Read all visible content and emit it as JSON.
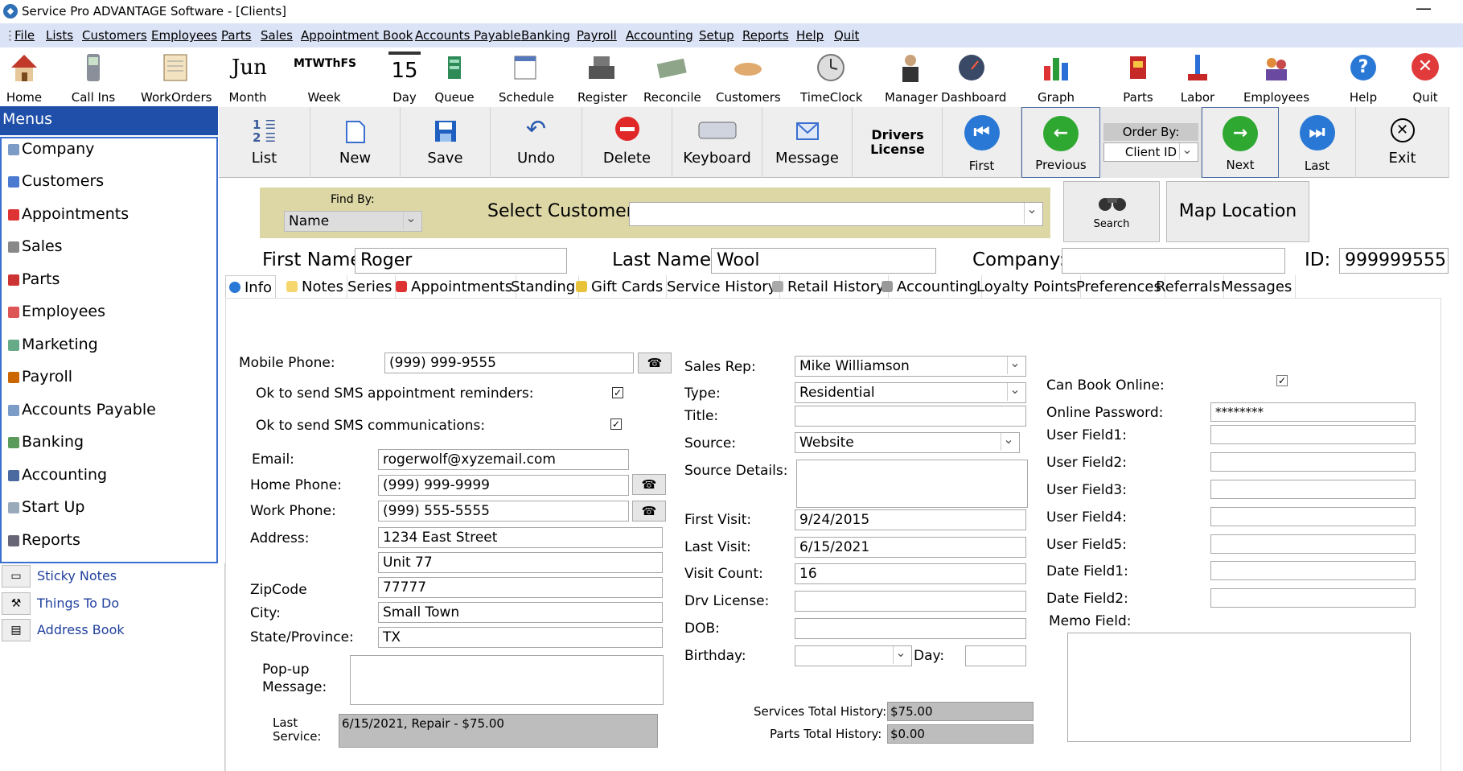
{
  "window": {
    "title": "Service Pro ADVANTAGE Software - [Clients]",
    "minimize": "—"
  },
  "menubar": [
    "File",
    "Lists",
    "Customers",
    "Employees",
    "Parts",
    "Sales",
    "Appointment Book",
    "Accounts Payable",
    "Banking",
    "Payroll",
    "Accounting",
    "Setup",
    "Reports",
    "Help",
    "Quit"
  ],
  "toolbar": {
    "home": "Home",
    "callins": "Call Ins",
    "workorders": "WorkOrders",
    "month": "Month",
    "month_icon": "Jun",
    "week": "Week",
    "week_icon": "MTWThFS",
    "day": "Day",
    "day_icon": "15",
    "queue": "Queue",
    "schedule": "Schedule",
    "register": "Register",
    "reconcile": "Reconcile",
    "customers": "Customers",
    "timeclock": "TimeClock",
    "manager": "Manager",
    "dashboard": "Dashboard",
    "graph": "Graph",
    "parts": "Parts",
    "labor": "Labor",
    "employees": "Employees",
    "help": "Help",
    "quit": "Quit"
  },
  "sidebar": {
    "header": "Menus",
    "items": [
      "Company",
      "Customers",
      "Appointments",
      "Sales",
      "Parts",
      "Employees",
      "Marketing",
      "Payroll",
      "Accounts Payable",
      "Banking",
      "Accounting",
      "Start Up",
      "Reports"
    ],
    "extras": [
      "Sticky Notes",
      "Things To Do",
      "Address Book"
    ]
  },
  "commands": {
    "list": "List",
    "new": "New",
    "save": "Save",
    "undo": "Undo",
    "delete": "Delete",
    "keyboard": "Keyboard",
    "message": "Message",
    "drivers_license": "Drivers License",
    "first": "First",
    "previous": "Previous",
    "order_by_label": "Order By:",
    "order_by_value": "Client ID",
    "next": "Next",
    "last": "Last",
    "exit": "Exit"
  },
  "find": {
    "find_by_label": "Find By:",
    "find_by_value": "Name",
    "select_customer_label": "Select Customer",
    "select_customer_value": "",
    "search": "Search",
    "map_location": "Map Location"
  },
  "header_fields": {
    "first_name_label": "First Name:",
    "first_name": "Roger",
    "last_name_label": "Last Name:",
    "last_name": "Wool",
    "company_label": "Company:",
    "company": "",
    "id_label": "ID:",
    "id": "999999555"
  },
  "tabs": [
    "Info",
    "Notes",
    "Series",
    "Appointments",
    "Standing",
    "Gift Cards",
    "Service History",
    "Retail History",
    "Accounting",
    "Loyalty Points",
    "Preferences",
    "Referrals",
    "Messages"
  ],
  "info": {
    "mobile_label": "Mobile Phone:",
    "mobile": "(999) 999-9555",
    "sms_reminders_label": "Ok to send SMS appointment reminders:",
    "sms_reminders": true,
    "sms_comm_label": "Ok to send SMS communications:",
    "sms_comm": true,
    "email_label": "Email:",
    "email": "rogerwolf@xyzemail.com",
    "home_label": "Home Phone:",
    "home": "(999) 999-9999",
    "work_label": "Work Phone:",
    "work": "(999) 555-5555",
    "address_label": "Address:",
    "address1": "1234 East Street",
    "address2": "Unit 77",
    "zip_label": "ZipCode",
    "zip": "77777",
    "city_label": "City:",
    "city": "Small Town",
    "state_label": "State/Province:",
    "state": "TX",
    "popup_label1": "Pop-up",
    "popup_label2": "Message:",
    "popup": "",
    "last_service_label1": "Last",
    "last_service_label2": "Service:",
    "last_service": "6/15/2021, Repair - $75.00",
    "sales_rep_label": "Sales Rep:",
    "sales_rep": "Mike Williamson",
    "type_label": "Type:",
    "type": "Residential",
    "title_label": "Title:",
    "title": "",
    "source_label": "Source:",
    "source": "Website",
    "source_details_label": "Source Details:",
    "source_details": "",
    "first_visit_label": "First Visit:",
    "first_visit": "9/24/2015",
    "last_visit_label": "Last Visit:",
    "last_visit": "6/15/2021",
    "visit_count_label": "Visit Count:",
    "visit_count": "16",
    "drv_label": "Drv License:",
    "drv": "",
    "dob_label": "DOB:",
    "dob": "",
    "birthday_label": "Birthday:",
    "birthday": "",
    "day_label": "Day:",
    "day": "",
    "services_total_label": "Services Total History:",
    "services_total": "$75.00",
    "parts_total_label": "Parts Total History:",
    "parts_total": "$0.00",
    "can_book_label": "Can Book Online:",
    "can_book": true,
    "password_label": "Online Password:",
    "password": "********",
    "uf1_label": "User Field1:",
    "uf2_label": "User Field2:",
    "uf3_label": "User Field3:",
    "uf4_label": "User Field4:",
    "uf5_label": "User Field5:",
    "df1_label": "Date Field1:",
    "df2_label": "Date Field2:",
    "memo_label": "Memo Field:"
  }
}
